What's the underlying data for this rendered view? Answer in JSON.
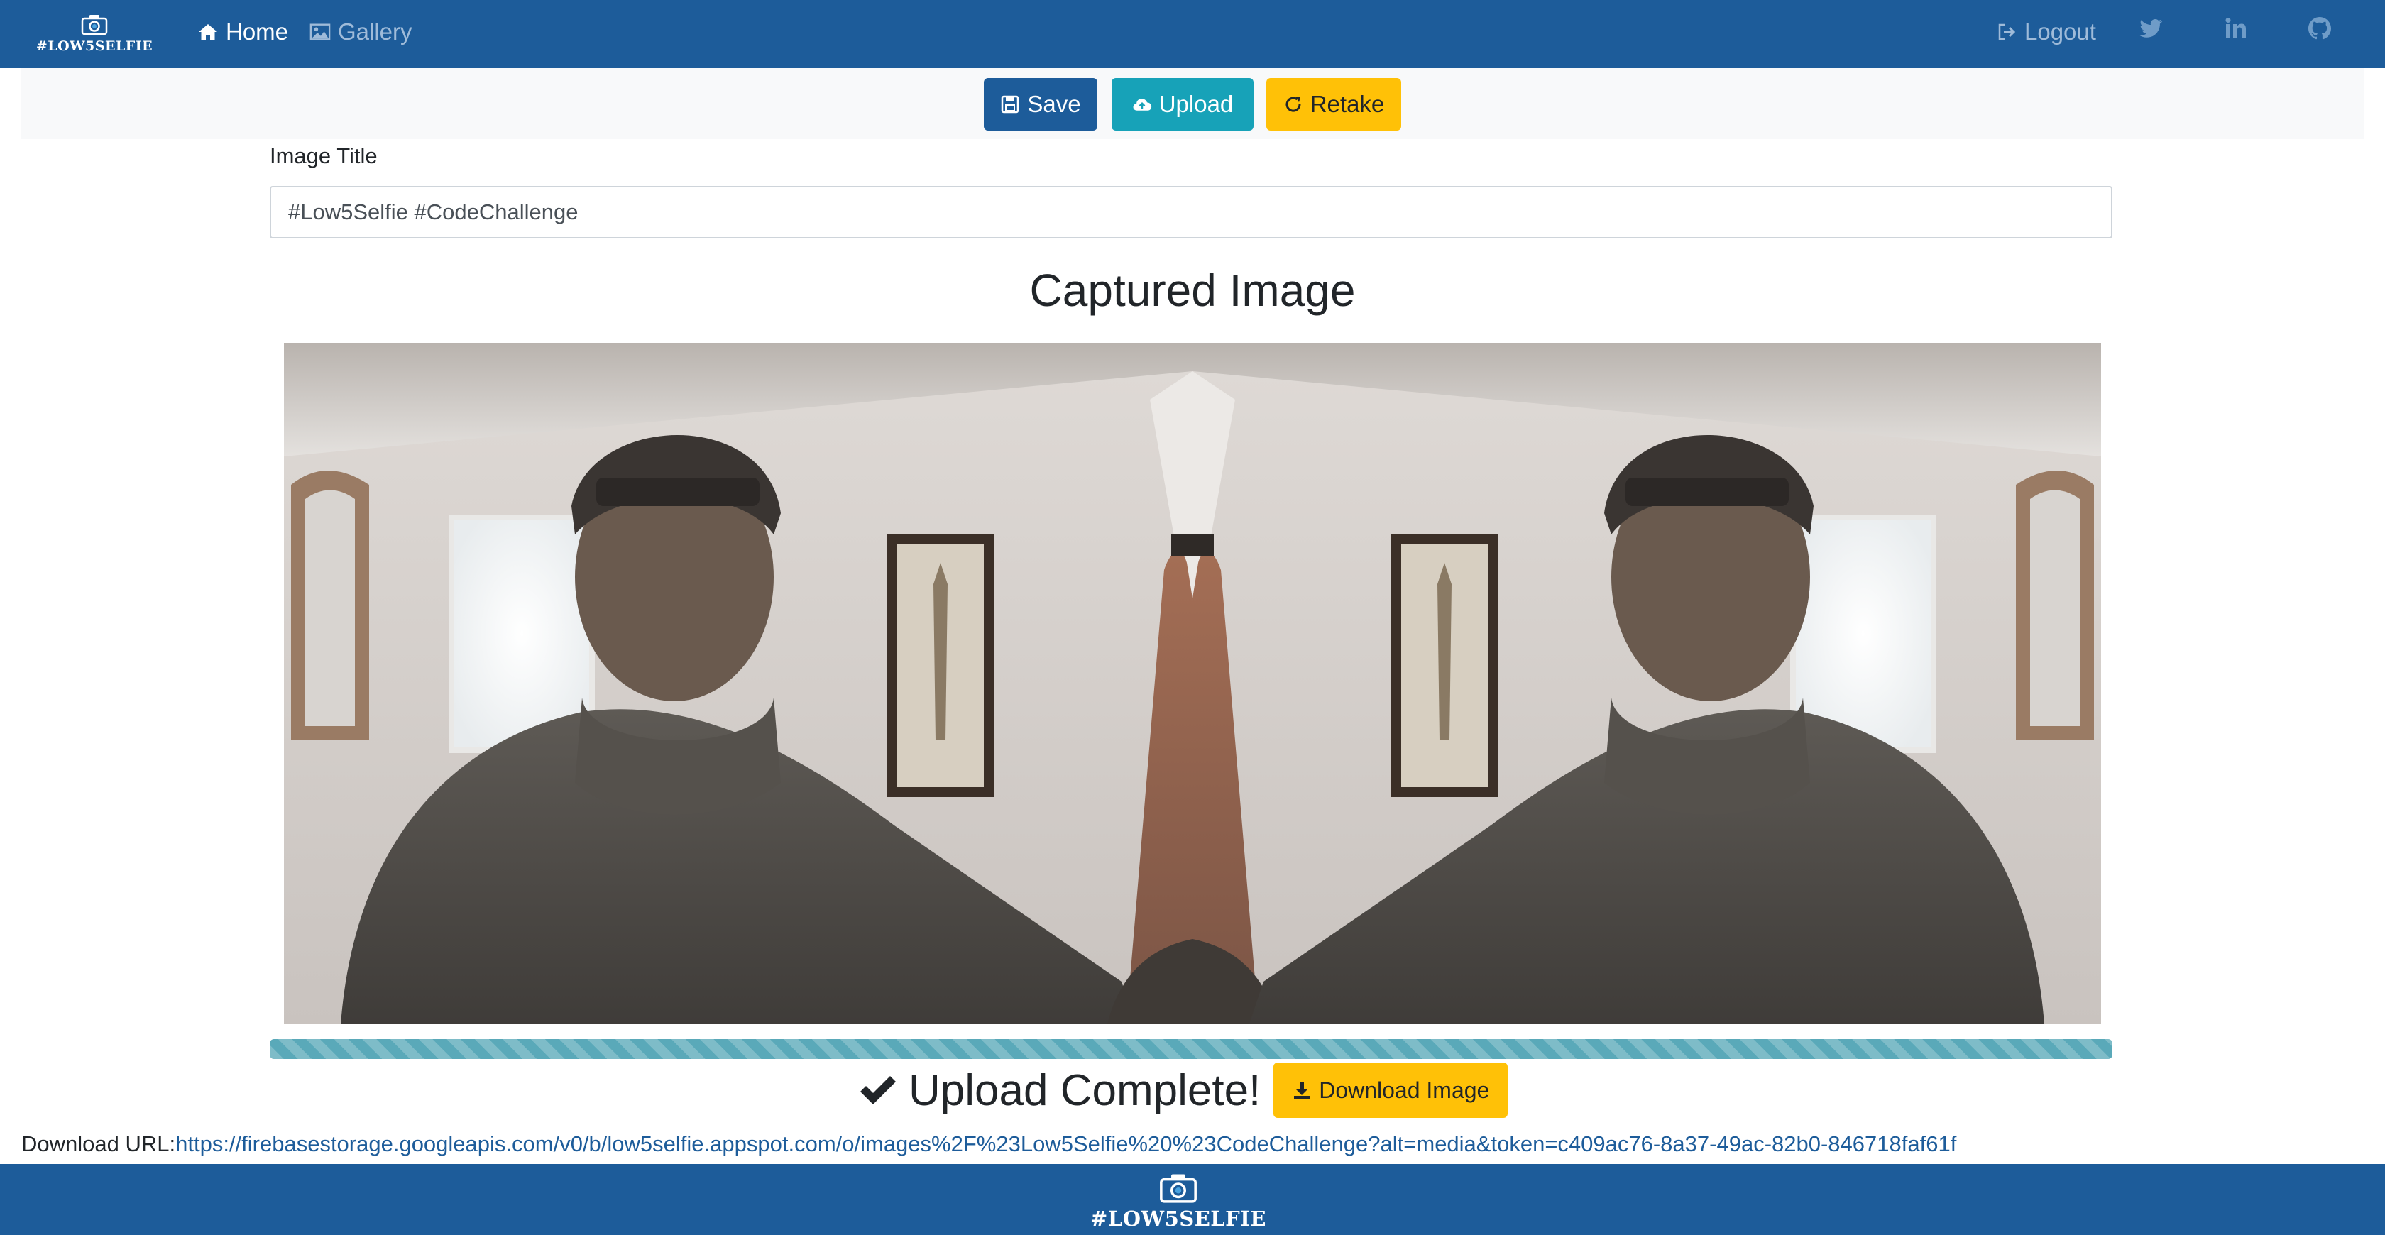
{
  "nav": {
    "brand": "#LOW5SELFIE",
    "home_label": "Home",
    "gallery_label": "Gallery",
    "logout_label": "Logout",
    "social_icons": [
      "twitter-icon",
      "linkedin-icon",
      "github-icon"
    ]
  },
  "toolbar": {
    "save_label": "Save",
    "upload_label": "Upload",
    "retake_label": "Retake"
  },
  "form": {
    "title_label": "Image Title",
    "title_value": "#Low5Selfie #CodeChallenge"
  },
  "captured_heading": "Captured Image",
  "upload": {
    "progress_percent": 100,
    "complete_text": "Upload Complete!",
    "download_button_label": "Download Image",
    "download_url_label": "Download URL:",
    "download_url": "https://firebasestorage.googleapis.com/v0/b/low5selfie.appspot.com/o/images%2F%23Low5Selfie%20%23CodeChallenge?alt=media&token=c409ac76-8a37-49ac-82b0-846718faf61f"
  },
  "footer": {
    "brand": "#LOW5SELFIE"
  },
  "colors": {
    "primary": "#1d5c9a",
    "info": "#17a2b8",
    "warning": "#ffc107",
    "progress": "#5aa9b9"
  }
}
